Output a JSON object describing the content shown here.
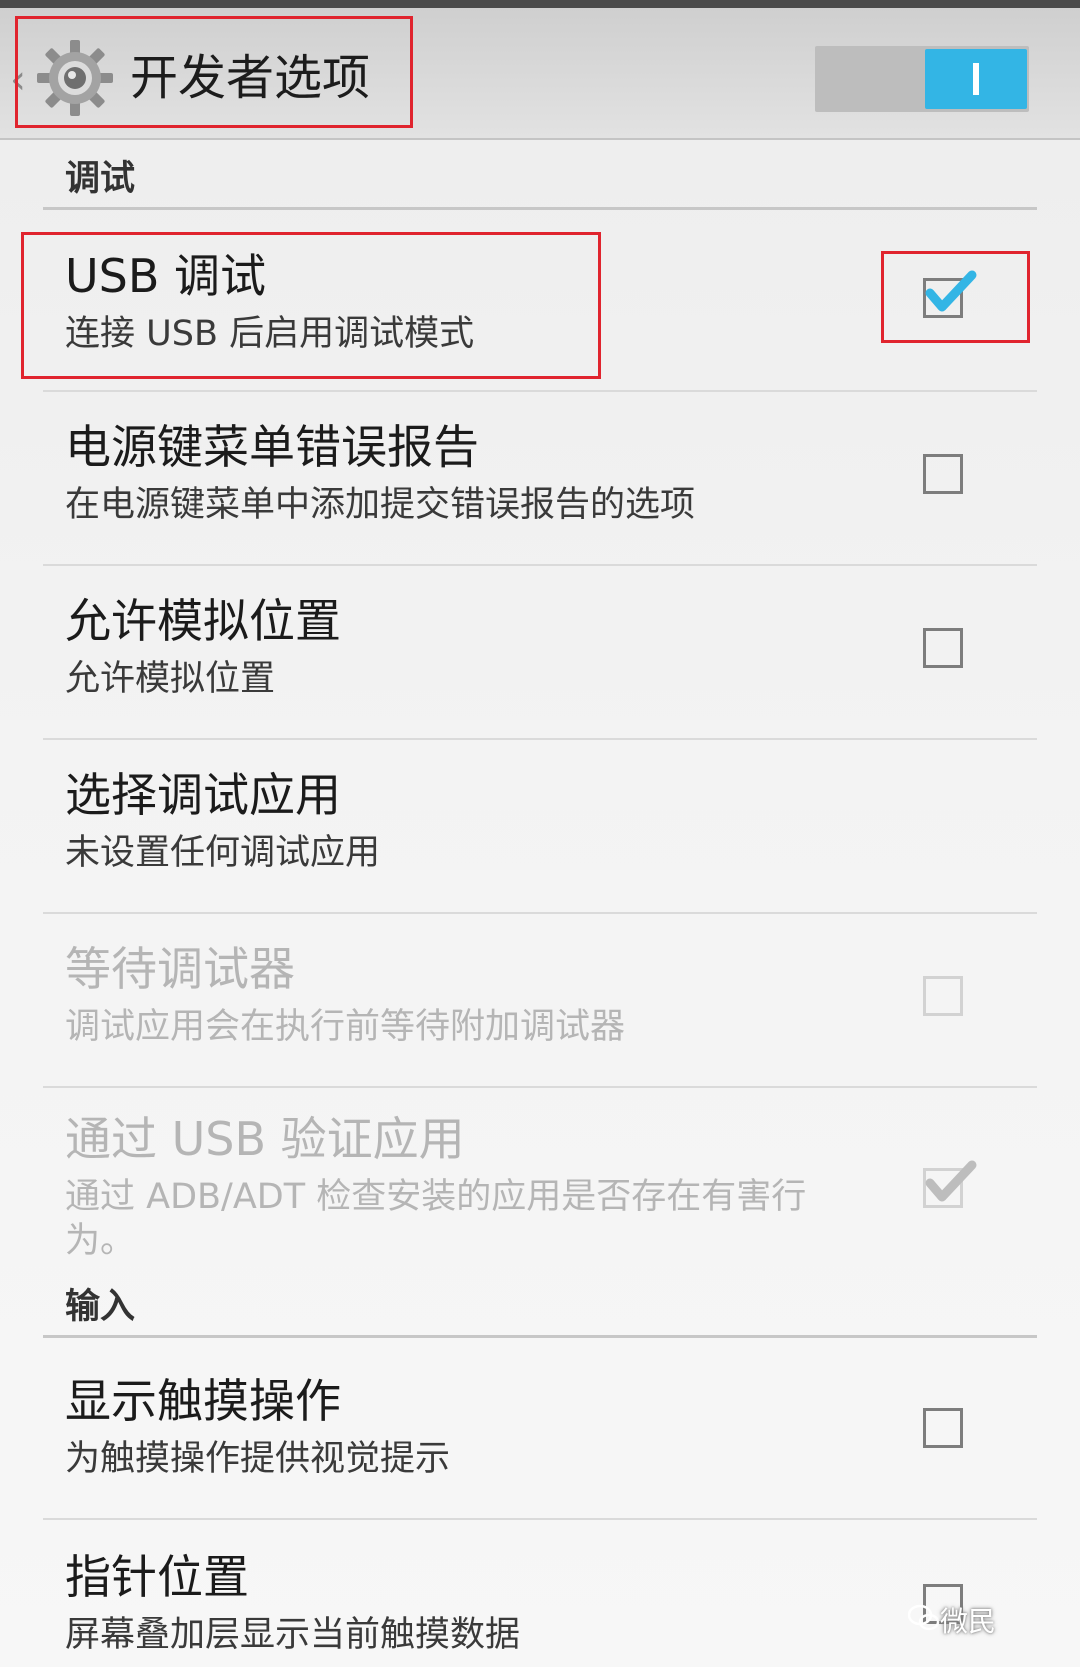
{
  "action_bar": {
    "title": "开发者选项",
    "back_icon": "chevron-left-icon",
    "app_icon": "gear-icon",
    "switch_on": true,
    "switch_label": "I",
    "accent": "#33b5e5"
  },
  "sections": [
    {
      "label": "调试"
    },
    {
      "label": "输入"
    }
  ],
  "items": [
    {
      "title": "USB 调试",
      "summary": "连接 USB 后启用调试模式",
      "checked": true,
      "enabled": true
    },
    {
      "title": "电源键菜单错误报告",
      "summary": "在电源键菜单中添加提交错误报告的选项",
      "checked": false,
      "enabled": true
    },
    {
      "title": "允许模拟位置",
      "summary": "允许模拟位置",
      "checked": false,
      "enabled": true
    },
    {
      "title": "选择调试应用",
      "summary": "未设置任何调试应用",
      "checked": null,
      "enabled": true
    },
    {
      "title": "等待调试器",
      "summary": "调试应用会在执行前等待附加调试器",
      "checked": false,
      "enabled": false
    },
    {
      "title": "通过 USB 验证应用",
      "summary": "通过 ADB/ADT 检查安装的应用是否存在有害行为。",
      "checked": true,
      "enabled": false
    },
    {
      "title": "显示触摸操作",
      "summary": "为触摸操作提供视觉提示",
      "checked": false,
      "enabled": true
    },
    {
      "title": "指针位置",
      "summary": "屏幕叠加层显示当前触摸数据",
      "checked": false,
      "enabled": true
    }
  ],
  "watermark": {
    "text": "微民",
    "icon": "wechat-icon"
  },
  "highlight_color": "#e0242e"
}
